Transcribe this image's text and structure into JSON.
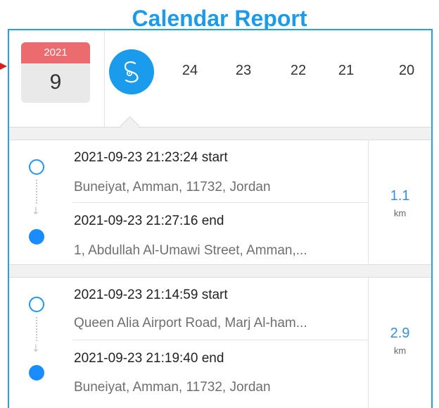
{
  "header": {
    "title": "Calendar Report"
  },
  "calendar": {
    "year": "2021",
    "month": "9"
  },
  "days": [
    "24",
    "23",
    "22",
    "21",
    "20"
  ],
  "colors": {
    "accent": "#1a9bec",
    "calendar_top": "#ec6b6f",
    "distance": "#3a8fd8",
    "title": "#1e9be8"
  },
  "trips": [
    {
      "start_time": "2021-09-23 21:23:24 start",
      "start_address": "Buneiyat, Amman, 11732, Jordan",
      "end_time": "2021-09-23 21:27:16 end",
      "end_address": "1, Abdullah Al-Umawi Street, Amman,...",
      "distance": "1.1",
      "unit": "km"
    },
    {
      "start_time": "2021-09-23 21:14:59 start",
      "start_address": "Queen Alia Airport Road, Marj Al-ham...",
      "end_time": "2021-09-23 21:19:40 end",
      "end_address": "Buneiyat, Amman, 11732, Jordan",
      "distance": "2.9",
      "unit": "km"
    }
  ]
}
